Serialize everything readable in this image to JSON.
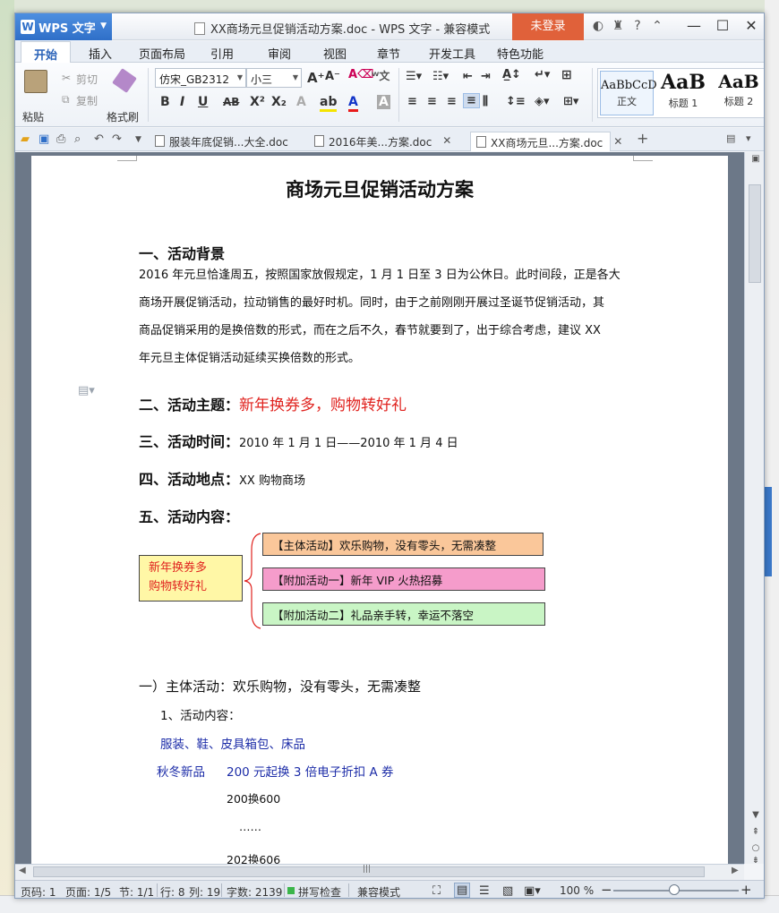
{
  "titlebar": {
    "app_name": "WPS 文字",
    "doc_title": "XX商场元旦促销活动方案.doc - WPS 文字 - 兼容模式",
    "login_label": "未登录",
    "icons": [
      "skin-icon",
      "shirt-icon",
      "help-icon",
      "collapse-icon"
    ],
    "help_label": "?"
  },
  "tabs": [
    "开始",
    "插入",
    "页面布局",
    "引用",
    "审阅",
    "视图",
    "章节",
    "开发工具",
    "特色功能"
  ],
  "ribbon": {
    "paste": "粘贴",
    "cut": "剪切",
    "copy": "复制",
    "format_painter": "格式刷",
    "font_name": "仿宋_GB2312",
    "font_size": "小三",
    "styles": [
      {
        "sample": "AaBbCcD",
        "name": "正文"
      },
      {
        "sample": "AaB",
        "name": "标题 1"
      },
      {
        "sample": "AaB",
        "name": "标题 2"
      }
    ]
  },
  "doc_tabs": [
    {
      "label": "服装年底促销...大全.doc"
    },
    {
      "label": "2016年美...方案.doc"
    },
    {
      "label": "XX商场元旦...方案.doc"
    }
  ],
  "document": {
    "title": "商场元旦促销活动方案",
    "s1_heading": "一、活动背景",
    "s1_lines": [
      "2016 年元旦恰逢周五，按照国家放假规定，1 月 1 日至 3 日为公休日。此时间段，正是各大",
      "商场开展促销活动，拉动销售的最好时机。同时，由于之前刚刚开展过圣诞节促销活动，其",
      "商品促销采用的是换倍数的形式，而在之后不久，春节就要到了，出于综合考虑，建议 XX",
      "年元旦主体促销活动延续买换倍数的形式。"
    ],
    "s2_heading": "二、活动主题：",
    "s2_value": "新年换券多，购物转好礼",
    "s3_heading": "三、活动时间：",
    "s3_value": "2010 年 1 月 1 日——2010 年 1 月 4 日",
    "s4_heading": "四、活动地点：",
    "s4_value": "XX 购物商场",
    "s5_heading": "五、活动内容：",
    "diagram": {
      "left_box_lines": [
        "新年换券多",
        "购物转好礼"
      ],
      "items": [
        {
          "text": "【主体活动】欢乐购物，没有零头，无需凑整",
          "color": "#fac79a"
        },
        {
          "text": "【附加活动一】新年 VIP 火热招募",
          "color": "#f59ccb"
        },
        {
          "text": "【附加活动二】礼品亲手转，幸运不落空",
          "color": "#c9f5c5"
        }
      ]
    },
    "sub1": "一）主体活动：欢乐购物，没有零头，无需凑整",
    "sub1_1": "1、活动内容：",
    "categories": "服装、鞋、皮具箱包、床品",
    "line_a_left": "秋冬新品",
    "line_a_right": "200 元起换 3 倍电子折扣 A 券",
    "line_b": "200换600",
    "line_c": "……",
    "line_d": "202换606"
  },
  "statusbar": {
    "page_code": "页码: 1",
    "pages": "页面: 1/5",
    "section": "节: 1/1",
    "row": "行: 8",
    "col": "列: 19",
    "words": "字数: 2139",
    "spell": "拼写检查",
    "compat": "兼容模式",
    "zoom": "100 %"
  }
}
